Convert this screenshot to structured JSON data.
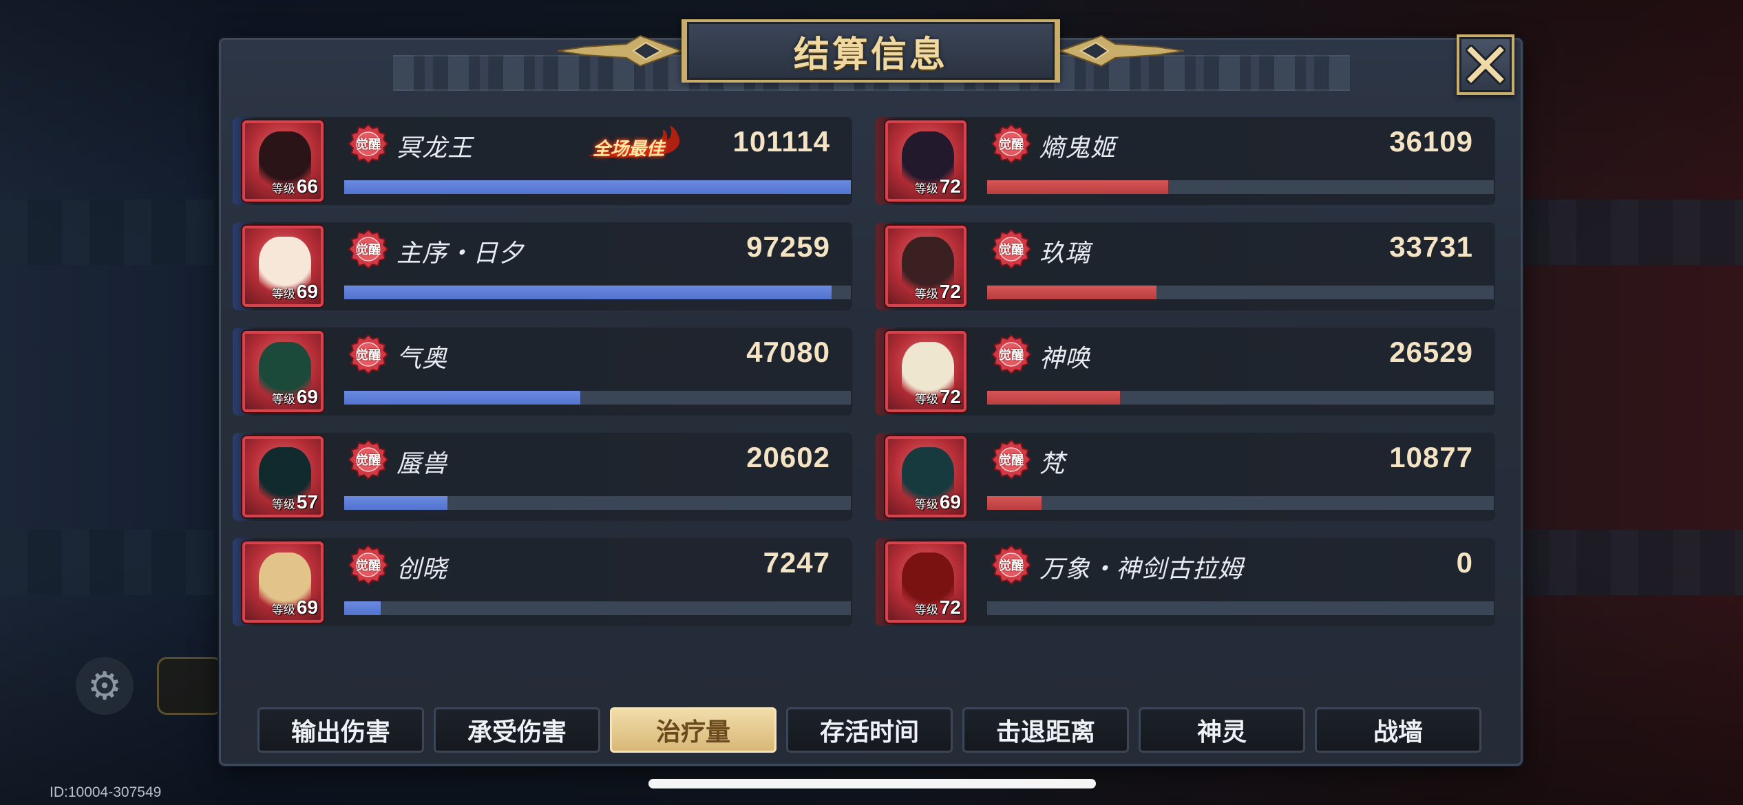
{
  "title": "结算信息",
  "badge_text": "觉醒",
  "level_prefix": "等级",
  "best_tag": "全场最佳",
  "id_text": "ID:10004-307549",
  "left_team": {
    "color": "#5273cf",
    "max": 101114,
    "heroes": [
      {
        "name": "冥龙王",
        "level": "66",
        "value": "101114",
        "fraction": 1.0,
        "best": true,
        "portrait": "#2a1418"
      },
      {
        "name": "主序・日夕",
        "level": "69",
        "value": "97259",
        "fraction": 0.962,
        "best": false,
        "portrait": "#f6e7d8"
      },
      {
        "name": "气奥",
        "level": "69",
        "value": "47080",
        "fraction": 0.466,
        "best": false,
        "portrait": "#1b4a3a"
      },
      {
        "name": "蜃兽",
        "level": "57",
        "value": "20602",
        "fraction": 0.204,
        "best": false,
        "portrait": "#102a2e"
      },
      {
        "name": "创晓",
        "level": "69",
        "value": "7247",
        "fraction": 0.072,
        "best": false,
        "portrait": "#e2c38a"
      }
    ]
  },
  "right_team": {
    "color": "#b93e3f",
    "max": 101114,
    "heroes": [
      {
        "name": "熵鬼姬",
        "level": "72",
        "value": "36109",
        "fraction": 0.357,
        "portrait": "#221a2c"
      },
      {
        "name": "玖璃",
        "level": "72",
        "value": "33731",
        "fraction": 0.334,
        "portrait": "#3a2020"
      },
      {
        "name": "神唤",
        "level": "72",
        "value": "26529",
        "fraction": 0.262,
        "portrait": "#efe6d0"
      },
      {
        "name": "梵",
        "level": "69",
        "value": "10877",
        "fraction": 0.108,
        "portrait": "#163a3e"
      },
      {
        "name": "万象・神剑古拉姆",
        "level": "72",
        "value": "0",
        "fraction": 0.0,
        "portrait": "#7a1212"
      }
    ]
  },
  "tabs": [
    {
      "label": "输出伤害",
      "active": false
    },
    {
      "label": "承受伤害",
      "active": false
    },
    {
      "label": "治疗量",
      "active": true
    },
    {
      "label": "存活时间",
      "active": false
    },
    {
      "label": "击退距离",
      "active": false
    },
    {
      "label": "神灵",
      "active": false
    },
    {
      "label": "战墙",
      "active": false
    }
  ],
  "colors": {
    "title_gold": "#f0d9a0",
    "frame_gold": "#c9ad6a",
    "value_cream": "#f4e4c4"
  }
}
